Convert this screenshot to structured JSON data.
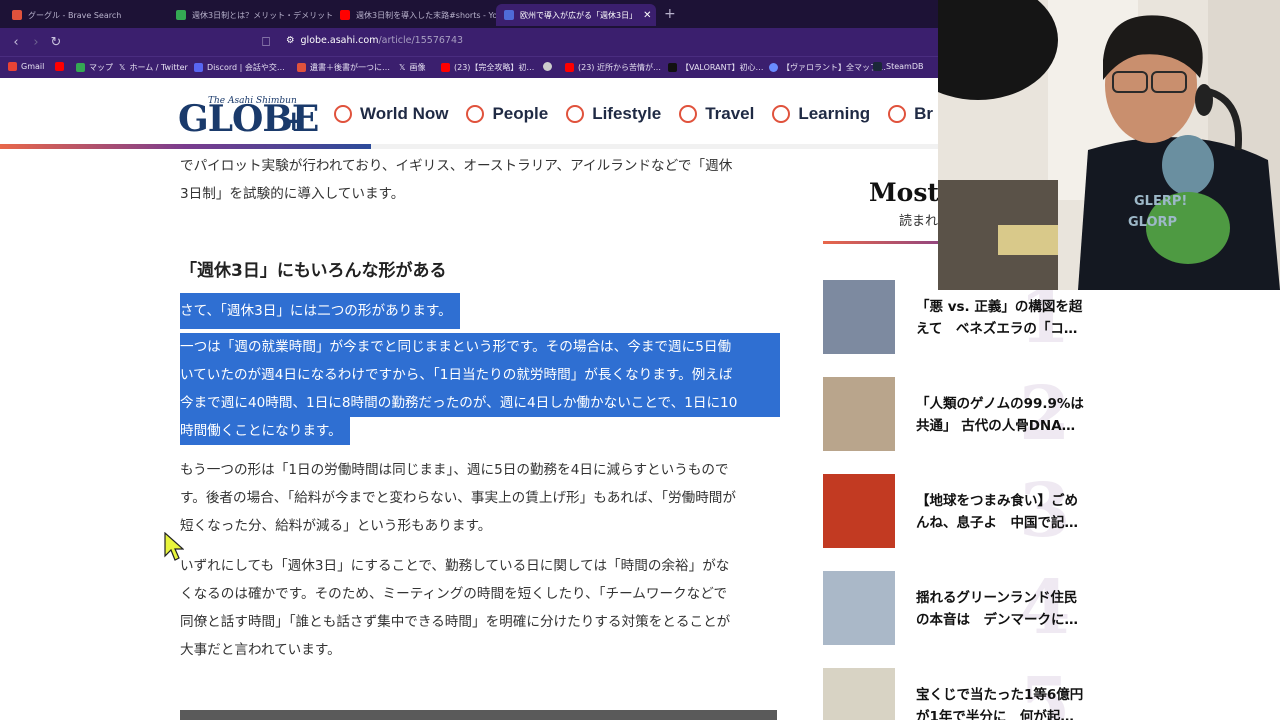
{
  "tabs": [
    {
      "label": "グーグル - Brave Search",
      "active": false,
      "favicon_color": "#e0523c"
    },
    {
      "label": "週休3日制とは？メリット・デメリットや導…",
      "active": false,
      "favicon_color": "#34a853"
    },
    {
      "label": "週休3日制を導入した末路#shorts - Yo…",
      "active": false,
      "favicon_color": "#ff0000"
    },
    {
      "label": "欧州で導入が広がる「週休3日」",
      "active": true,
      "favicon_color": "#4f6bd8"
    }
  ],
  "address": {
    "domain": "globe.asahi.com",
    "path": "/article/15576743"
  },
  "bookmarks": [
    {
      "label": "Gmail",
      "color": "#ea4335"
    },
    {
      "label": "",
      "color": "#ff0000"
    },
    {
      "label": "マップ",
      "color": "#34a853"
    },
    {
      "label": "ホーム / Twitter",
      "color": "#ffffff"
    },
    {
      "label": "Discord | 会話や交…",
      "color": "#5865f2"
    },
    {
      "label": "遺書＋後書が一つに…",
      "color": "#e0523c"
    },
    {
      "label": "画像",
      "color": "#ffffff"
    },
    {
      "label": "(23)【完全攻略】初…",
      "color": "#ff0000"
    },
    {
      "label": "",
      "color": "#cccccc"
    },
    {
      "label": "(23) 近所から苦情が…",
      "color": "#ff0000"
    },
    {
      "label": "【VALORANT】初心…",
      "color": "#111111"
    },
    {
      "label": "【ヴァロラント】全マップ…",
      "color": "#6a8cff"
    },
    {
      "label": "SteamDB",
      "color": "#1b2838"
    }
  ],
  "site": {
    "logo_sub": "The Asahi Shimbun",
    "logo_main": "GLOBE",
    "logo_plus": "+",
    "nav": [
      "World Now",
      "People",
      "Lifestyle",
      "Travel",
      "Learning",
      "Br"
    ],
    "read_progress": 0.29
  },
  "article": {
    "intro_1": "でパイロット実験が行われており、イギリス、オーストラリア、アイルランドなどで「週休",
    "intro_2": "3日制」を試験的に導入しています。",
    "heading": "「週休3日」にもいろんな形がある",
    "sel_p1": "さて、「週休3日」には二つの形があります。",
    "sel_p2_lines": [
      "一つは「週の就業時間」が今までと同じままという形です。その場合は、今まで週に5日働",
      "いていたのが週4日になるわけですから、「1日当たりの就労時間」が長くなります。例えば",
      "今まで週に40時間、1日に8時間の勤務だったのが、週に4日しか働かないことで、1日に10",
      "時間働くことになります。"
    ],
    "p3_lines": [
      "もう一つの形は「1日の労働時間は同じまま」、週に5日の勤務を4日に減らすというもので",
      "す。後者の場合、「給料が今までと変わらない、事実上の賃上げ形」もあれば、「労働時間が",
      "短くなった分、給料が減る」という形もあります。"
    ],
    "p4_lines": [
      "いずれにしても「週休3日」にすることで、勤務している日に関しては「時間の余裕」がな",
      "くなるのは確かです。そのため、ミーティングの時間を短くしたり、「チームワークなどで",
      "同僚と話す時間」「誰とも話さず集中できる時間」を明確に分けたりする対策をとることが",
      "大事だと言われています。"
    ]
  },
  "sidebar": {
    "title": "Most",
    "subtitle": "読まれ",
    "items": [
      {
        "rank": "1",
        "title": "「悪 vs. 正義」の構図を超えて　ベネズエラの「コ…",
        "thumb_color": "#7d8aa0"
      },
      {
        "rank": "2",
        "title": "「人類のゲノムの99.9%は共通」 古代の人骨DNA…",
        "thumb_color": "#b9a58c"
      },
      {
        "rank": "3",
        "title": "【地球をつまみ食い】ごめんね、息子よ　中国で記…",
        "thumb_color": "#c23a22"
      },
      {
        "rank": "4",
        "title": "揺れるグリーンランド住民の本音は　デンマークに…",
        "thumb_color": "#aab8c8"
      },
      {
        "rank": "5",
        "title": "宝くじで当たった1等6億円が1年で半分に　何が起…",
        "thumb_color": "#d8d3c4"
      }
    ]
  }
}
